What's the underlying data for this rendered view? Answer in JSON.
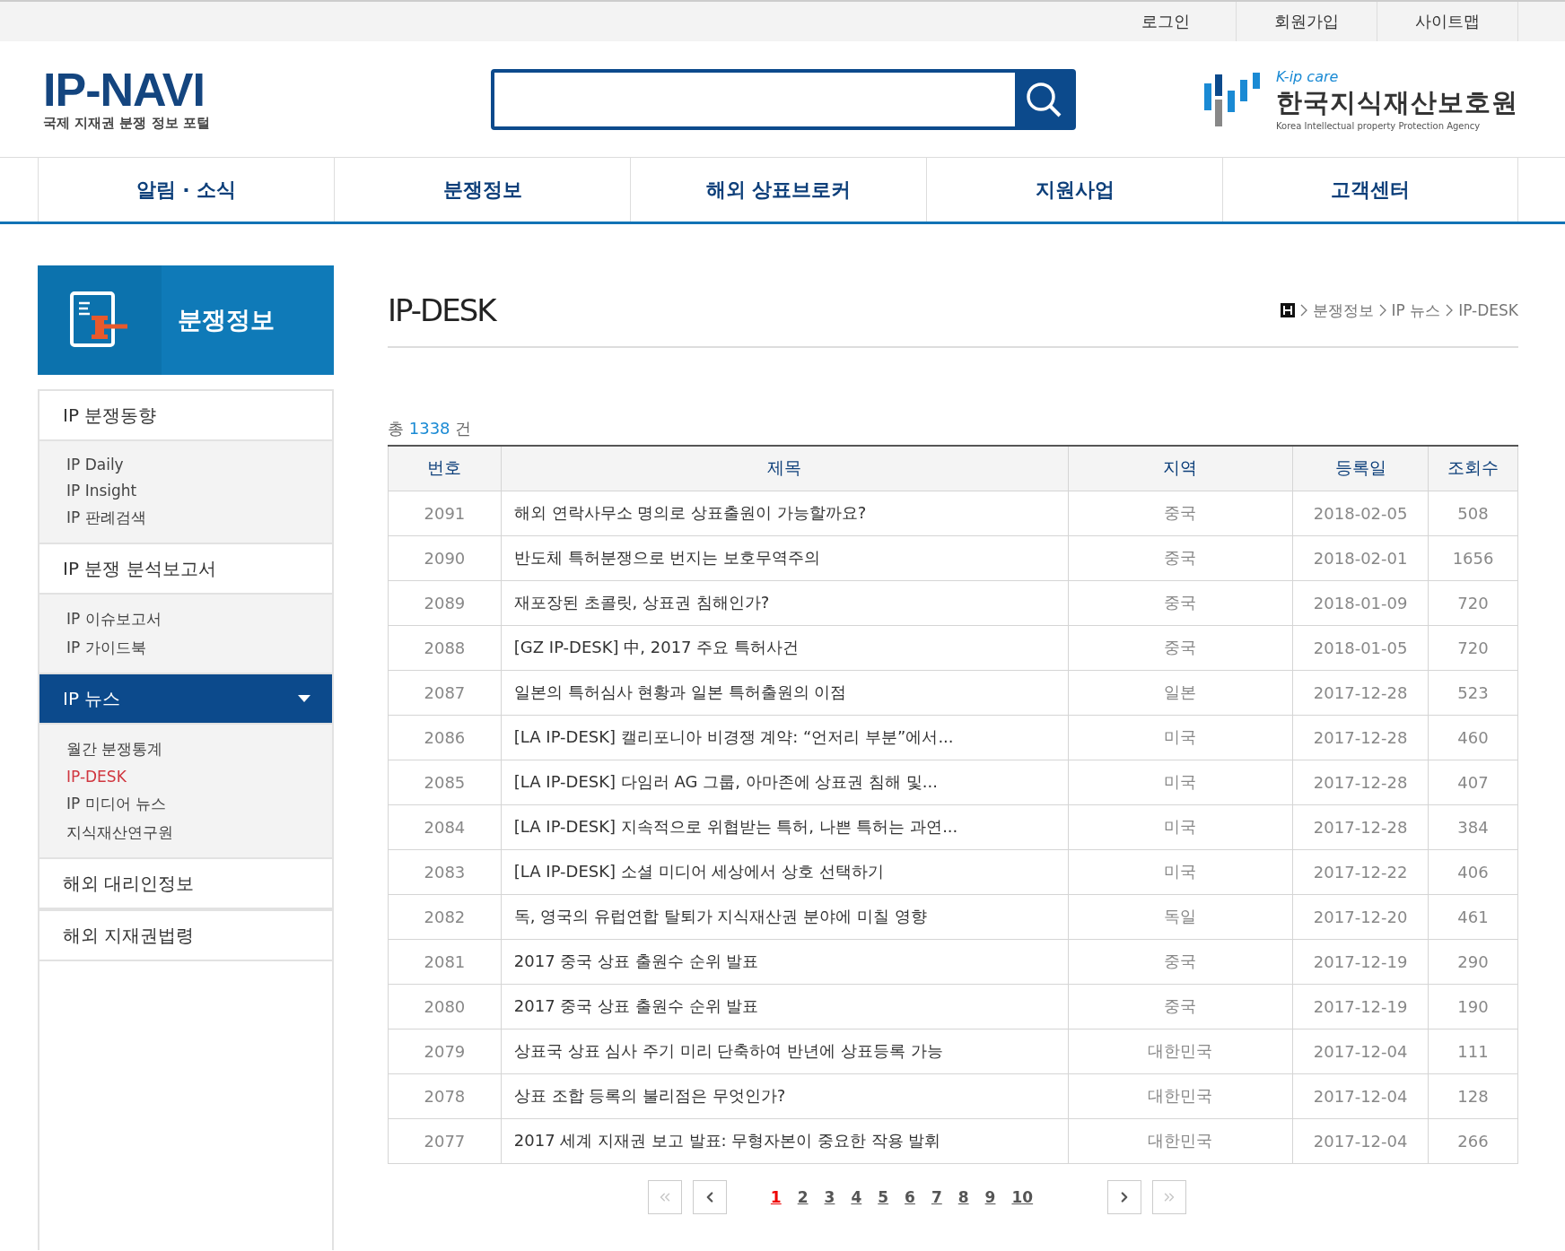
{
  "top_links": [
    "로그인",
    "회원가입",
    "사이트맵"
  ],
  "logo": {
    "name": "IP-NAVI",
    "tagline": "국제 지재권 분쟁 정보 포털"
  },
  "agency": {
    "brand": "K-ip care",
    "name": "한국지식재산보호원",
    "english": "Korea Intellectual property Protection Agency"
  },
  "nav": [
    {
      "label": "알림 · 소식",
      "selected": false
    },
    {
      "label": "분쟁정보",
      "selected": false
    },
    {
      "label": "해외 상표브로커",
      "selected": false
    },
    {
      "label": "지원사업",
      "selected": false
    },
    {
      "label": "고객센터",
      "selected": false
    }
  ],
  "sidebar": {
    "title": "분쟁정보",
    "items": [
      {
        "label": "IP 분쟁동향",
        "selected": false,
        "children": [
          {
            "label": "IP Daily",
            "selected": false
          },
          {
            "label": "IP Insight",
            "selected": false
          },
          {
            "label": "IP 판례검색",
            "selected": false
          }
        ]
      },
      {
        "label": "IP 분쟁 분석보고서",
        "selected": false,
        "children": [
          {
            "label": "IP 이슈보고서",
            "selected": false
          },
          {
            "label": "IP 가이드북",
            "selected": false
          }
        ]
      },
      {
        "label": "IP 뉴스",
        "selected": true,
        "children": [
          {
            "label": "월간 분쟁통계",
            "selected": false
          },
          {
            "label": "IP-DESK",
            "selected": true
          },
          {
            "label": "IP 미디어 뉴스",
            "selected": false
          },
          {
            "label": "지식재산연구원",
            "selected": false
          }
        ]
      },
      {
        "label": "해외 대리인정보",
        "selected": false
      },
      {
        "label": "해외 지재권법령",
        "selected": false
      }
    ]
  },
  "page_title": "IP-DESK",
  "breadcrumb": [
    "분쟁정보",
    "IP 뉴스",
    "IP-DESK"
  ],
  "total": {
    "prefix": "총",
    "count": "1338",
    "suffix": "건"
  },
  "table": {
    "columns": [
      "번호",
      "제목",
      "지역",
      "등록일",
      "조회수"
    ],
    "rows": [
      [
        "2091",
        "해외 연락사무소 명의로 상표출원이 가능할까요?",
        "중국",
        "2018-02-05",
        "508"
      ],
      [
        "2090",
        "반도체 특허분쟁으로 번지는 보호무역주의",
        "중국",
        "2018-02-01",
        "1656"
      ],
      [
        "2089",
        "재포장된 초콜릿, 상표권 침해인가?",
        "중국",
        "2018-01-09",
        "720"
      ],
      [
        "2088",
        "[GZ IP-DESK] 中, 2017 주요 특허사건",
        "중국",
        "2018-01-05",
        "720"
      ],
      [
        "2087",
        "일본의 특허심사 현황과 일본 특허출원의 이점",
        "일본",
        "2017-12-28",
        "523"
      ],
      [
        "2086",
        "[LA IP-DESK] 캘리포니아 비경쟁 계약: “언저리 부분”에서...",
        "미국",
        "2017-12-28",
        "460"
      ],
      [
        "2085",
        "[LA IP-DESK] 다임러 AG 그룹, 아마존에 상표권 침해 및...",
        "미국",
        "2017-12-28",
        "407"
      ],
      [
        "2084",
        "[LA IP-DESK] 지속적으로 위협받는 특허, 나쁜 특허는 과연...",
        "미국",
        "2017-12-28",
        "384"
      ],
      [
        "2083",
        "[LA IP-DESK] 소셜 미디어 세상에서 상호 선택하기",
        "미국",
        "2017-12-22",
        "406"
      ],
      [
        "2082",
        "독, 영국의 유럽연합 탈퇴가 지식재산권 분야에 미칠 영향",
        "독일",
        "2017-12-20",
        "461"
      ],
      [
        "2081",
        "2017 중국 상표 출원수 순위 발표",
        "중국",
        "2017-12-19",
        "290"
      ],
      [
        "2080",
        "2017 중국 상표 출원수 순위 발표",
        "중국",
        "2017-12-19",
        "190"
      ],
      [
        "2079",
        "상표국 상표 심사 주기 미리 단축하여 반년에 상표등록 가능",
        "대한민국",
        "2017-12-04",
        "111"
      ],
      [
        "2078",
        "상표 조합 등록의 불리점은 무엇인가?",
        "대한민국",
        "2017-12-04",
        "128"
      ],
      [
        "2077",
        "2017 세계 지재권 보고 발표: 무형자본이 중요한 작용 발휘",
        "대한민국",
        "2017-12-04",
        "266"
      ]
    ]
  },
  "pagination": {
    "first_disabled": true,
    "prev_disabled": false,
    "next_disabled": false,
    "last_disabled": true,
    "pages": [
      {
        "label": "1",
        "selected": true
      },
      {
        "label": "2",
        "selected": false
      },
      {
        "label": "3",
        "selected": false
      },
      {
        "label": "4",
        "selected": false
      },
      {
        "label": "5",
        "selected": false
      },
      {
        "label": "6",
        "selected": false
      },
      {
        "label": "7",
        "selected": false
      },
      {
        "label": "8",
        "selected": false
      },
      {
        "label": "9",
        "selected": false
      },
      {
        "label": "10",
        "selected": false
      }
    ]
  }
}
